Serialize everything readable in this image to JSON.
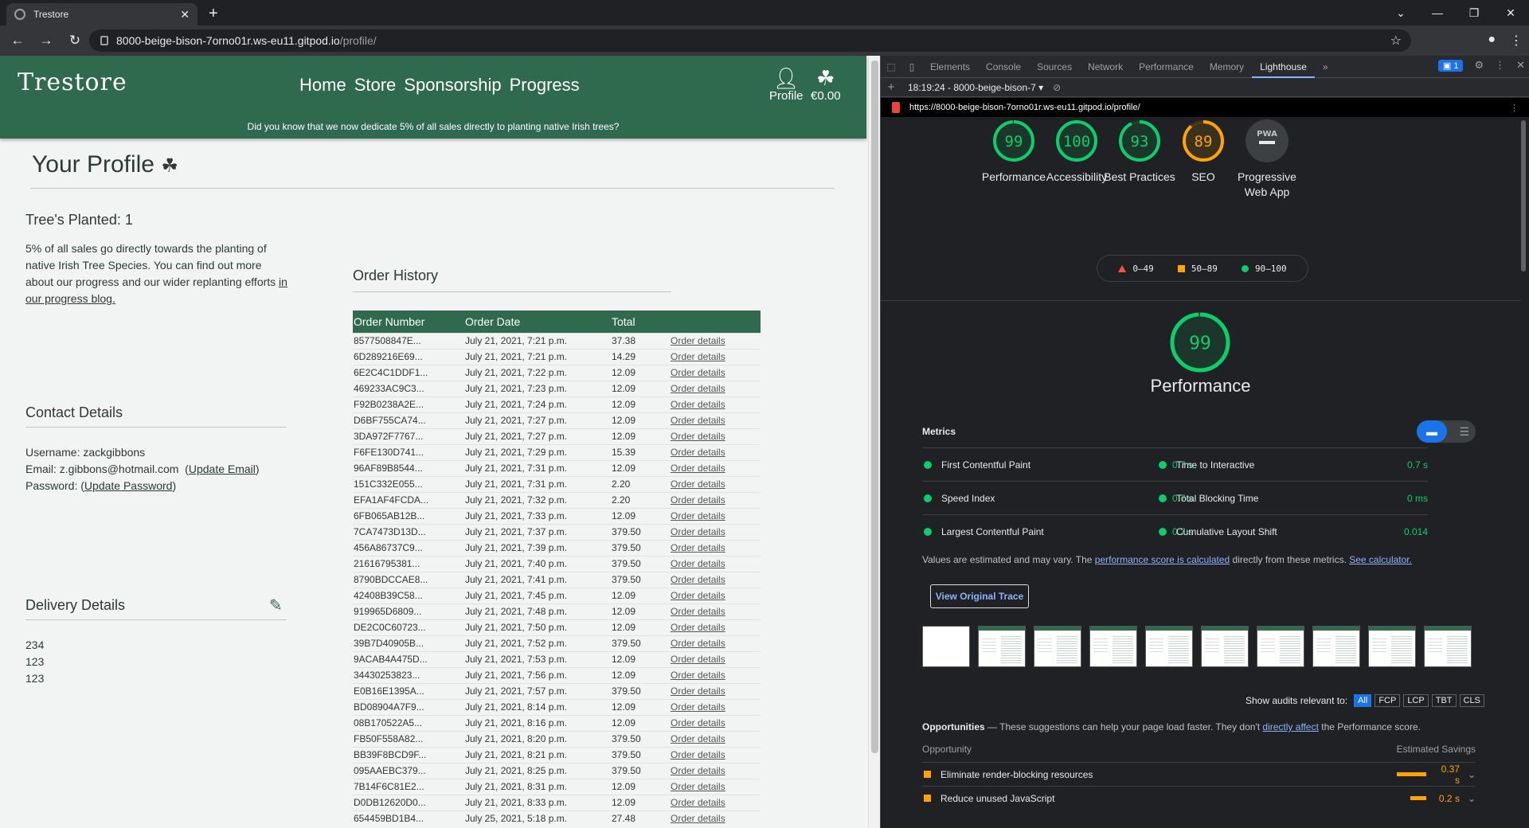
{
  "browser": {
    "tab_title": "Trestore",
    "url_host": "8000-beige-bison-7orno01r.ws-eu11.gitpod.io",
    "url_path": "/profile/"
  },
  "site": {
    "logo": "Trestore",
    "nav": [
      "Home",
      "Store",
      "Sponsorship",
      "Progress"
    ],
    "profile_label": "Profile",
    "cart_total": "€0.00",
    "promo": "Did you know that we now dedicate 5% of all sales directly to planting native Irish trees?"
  },
  "profile": {
    "title": "Your Profile",
    "trees_planted": "Tree's Planted: 1",
    "trees_text": "5% of all sales go directly towards the planting of native Irish Tree Species. You can find out more about our progress and our wider replanting efforts ",
    "trees_link": "in our progress blog.",
    "contact_title": "Contact Details",
    "username": "Username: zackgibbons",
    "email": "Email: z.gibbons@hotmail.com",
    "update_email": "Update Email",
    "password_label": "Password:",
    "update_password": "Update Password",
    "delivery_title": "Delivery Details",
    "delivery_lines": [
      "234",
      "123",
      "123"
    ]
  },
  "orders": {
    "title": "Order History",
    "columns": [
      "Order Number",
      "Order Date",
      "Total",
      ""
    ],
    "link_label": "Order details",
    "rows": [
      [
        "8577508847E...",
        "July 21, 2021, 7:21 p.m.",
        "37.38"
      ],
      [
        "6D289216E69...",
        "July 21, 2021, 7:21 p.m.",
        "14.29"
      ],
      [
        "6E2C4C1DDF1...",
        "July 21, 2021, 7:22 p.m.",
        "12.09"
      ],
      [
        "469233AC9C3...",
        "July 21, 2021, 7:23 p.m.",
        "12.09"
      ],
      [
        "F92B0238A2E...",
        "July 21, 2021, 7:24 p.m.",
        "12.09"
      ],
      [
        "D6BF755CA74...",
        "July 21, 2021, 7:27 p.m.",
        "12.09"
      ],
      [
        "3DA972F7767...",
        "July 21, 2021, 7:27 p.m.",
        "12.09"
      ],
      [
        "F6FE130D741...",
        "July 21, 2021, 7:29 p.m.",
        "15.39"
      ],
      [
        "96AF89B8544...",
        "July 21, 2021, 7:31 p.m.",
        "12.09"
      ],
      [
        "151C332E055...",
        "July 21, 2021, 7:31 p.m.",
        "2.20"
      ],
      [
        "EFA1AF4FCDA...",
        "July 21, 2021, 7:32 p.m.",
        "2.20"
      ],
      [
        "6FB065AB12B...",
        "July 21, 2021, 7:33 p.m.",
        "12.09"
      ],
      [
        "7CA7473D13D...",
        "July 21, 2021, 7:37 p.m.",
        "379.50"
      ],
      [
        "456A86737C9...",
        "July 21, 2021, 7:39 p.m.",
        "379.50"
      ],
      [
        "21616795381...",
        "July 21, 2021, 7:40 p.m.",
        "379.50"
      ],
      [
        "8790BDCCAE8...",
        "July 21, 2021, 7:41 p.m.",
        "379.50"
      ],
      [
        "42408B39C58...",
        "July 21, 2021, 7:45 p.m.",
        "12.09"
      ],
      [
        "919965D6809...",
        "July 21, 2021, 7:48 p.m.",
        "12.09"
      ],
      [
        "DE2C0C60723...",
        "July 21, 2021, 7:50 p.m.",
        "12.09"
      ],
      [
        "39B7D40905B...",
        "July 21, 2021, 7:52 p.m.",
        "379.50"
      ],
      [
        "9ACAB4A475D...",
        "July 21, 2021, 7:53 p.m.",
        "12.09"
      ],
      [
        "34430253823...",
        "July 21, 2021, 7:56 p.m.",
        "12.09"
      ],
      [
        "E0B16E1395A...",
        "July 21, 2021, 7:57 p.m.",
        "379.50"
      ],
      [
        "BD08904A7F9...",
        "July 21, 2021, 8:14 p.m.",
        "12.09"
      ],
      [
        "08B170522A5...",
        "July 21, 2021, 8:16 p.m.",
        "12.09"
      ],
      [
        "FB50F558A82...",
        "July 21, 2021, 8:20 p.m.",
        "379.50"
      ],
      [
        "BB39F8BCD9F...",
        "July 21, 2021, 8:21 p.m.",
        "379.50"
      ],
      [
        "095AAEBC379...",
        "July 21, 2021, 8:25 p.m.",
        "379.50"
      ],
      [
        "7B14F6C81E2...",
        "July 21, 2021, 8:31 p.m.",
        "12.09"
      ],
      [
        "D0DB12620D0...",
        "July 21, 2021, 8:33 p.m.",
        "12.09"
      ],
      [
        "654459BD1B4...",
        "July 25, 2021, 5:18 p.m.",
        "27.48"
      ]
    ]
  },
  "devtools": {
    "tabs": [
      "Elements",
      "Console",
      "Sources",
      "Network",
      "Performance",
      "Memory",
      "Lighthouse"
    ],
    "active_tab": "Lighthouse",
    "issues_count": "1",
    "report_select": "18:19:24 - 8000-beige-bison-7",
    "report_url": "https://8000-beige-bison-7orno01r.ws-eu11.gitpod.io/profile/",
    "scores": [
      {
        "value": 99,
        "label": "Performance",
        "color": "#0cce6b"
      },
      {
        "value": 100,
        "label": "Accessibility",
        "color": "#0cce6b"
      },
      {
        "value": 93,
        "label": "Best Practices",
        "color": "#0cce6b"
      },
      {
        "value": 89,
        "label": "SEO",
        "color": "#ffa400"
      }
    ],
    "pwa_label": "Progressive Web App",
    "pwa_badge": "PWA",
    "legend": [
      "0–49",
      "50–89",
      "90–100"
    ],
    "perf_score": 99,
    "perf_title": "Performance",
    "metrics_title": "Metrics",
    "metrics": [
      {
        "name": "First Contentful Paint",
        "value": "0.7 s"
      },
      {
        "name": "Time to Interactive",
        "value": "0.7 s"
      },
      {
        "name": "Speed Index",
        "value": "0.7 s"
      },
      {
        "name": "Total Blocking Time",
        "value": "0 ms"
      },
      {
        "name": "Largest Contentful Paint",
        "value": "0.7 s"
      },
      {
        "name": "Cumulative Layout Shift",
        "value": "0.014"
      }
    ],
    "note_pre": "Values are estimated and may vary. The ",
    "note_link1": "performance score is calculated",
    "note_mid": " directly from these metrics. ",
    "note_link2": "See calculator.",
    "trace_button": "View Original Trace",
    "audits_label": "Show audits relevant to:",
    "audit_filters": [
      "All",
      "FCP",
      "LCP",
      "TBT",
      "CLS"
    ],
    "opportunities_title": "Opportunities",
    "opportunities_desc": " — These suggestions can help your page load faster. They don't ",
    "opportunities_link": "directly affect",
    "opportunities_tail": " the Performance score.",
    "opp_col_left": "Opportunity",
    "opp_col_right": "Estimated Savings",
    "opportunities": [
      {
        "name": "Eliminate render-blocking resources",
        "value": "0.37 s",
        "savings_s": 0.37
      },
      {
        "name": "Reduce unused JavaScript",
        "value": "0.2 s",
        "savings_s": 0.2
      }
    ]
  }
}
